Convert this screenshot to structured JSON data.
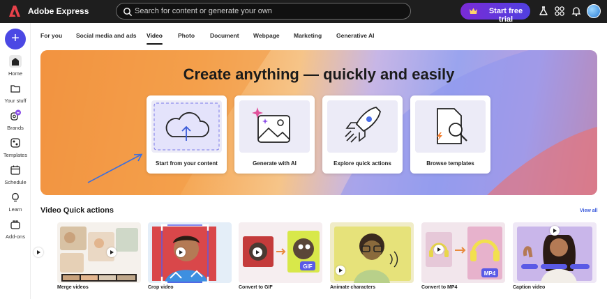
{
  "header": {
    "app_title": "Adobe Express",
    "search_placeholder": "Search for content or generate your own",
    "trial_label": "Start free trial",
    "icons": [
      "adobe-logo-icon",
      "search-icon",
      "crown-icon",
      "flask-icon",
      "apps-grid-icon",
      "bell-icon",
      "avatar"
    ]
  },
  "rail": {
    "create_icon": "plus-icon",
    "items": [
      {
        "label": "Home",
        "icon": "home-icon",
        "active": true
      },
      {
        "label": "Your stuff",
        "icon": "folder-icon"
      },
      {
        "label": "Brands",
        "icon": "brand-icon"
      },
      {
        "label": "Templates",
        "icon": "templates-icon"
      },
      {
        "label": "Schedule",
        "icon": "calendar-icon"
      },
      {
        "label": "Learn",
        "icon": "lightbulb-icon"
      },
      {
        "label": "Add-ons",
        "icon": "addons-icon"
      }
    ]
  },
  "tabs": [
    {
      "label": "For you"
    },
    {
      "label": "Social media and ads"
    },
    {
      "label": "Video",
      "active": true
    },
    {
      "label": "Photo"
    },
    {
      "label": "Document"
    },
    {
      "label": "Webpage"
    },
    {
      "label": "Marketing"
    },
    {
      "label": "Generative AI"
    }
  ],
  "hero": {
    "title": "Create anything — quickly and easily",
    "cards": [
      {
        "label": "Start from your content",
        "icon": "cloud-upload-icon"
      },
      {
        "label": "Generate with AI",
        "icon": "ai-image-icon"
      },
      {
        "label": "Explore quick actions",
        "icon": "rocket-icon"
      },
      {
        "label": "Browse templates",
        "icon": "template-search-icon"
      }
    ]
  },
  "quick_actions": {
    "title": "Video Quick actions",
    "view_all": "View all",
    "items": [
      {
        "label": "Merge videos"
      },
      {
        "label": "Crop video"
      },
      {
        "label": "Convert to GIF",
        "badge": "GIF"
      },
      {
        "label": "Animate characters"
      },
      {
        "label": "Convert to MP4",
        "badge": "MP4"
      },
      {
        "label": "Caption video"
      }
    ]
  },
  "colors": {
    "topbar": "#1e1e1e",
    "accent": "#4b48e4",
    "trial_gradient_start": "#7a2bd6",
    "trial_gradient_end": "#5040e0",
    "link": "#3b5bdb"
  }
}
